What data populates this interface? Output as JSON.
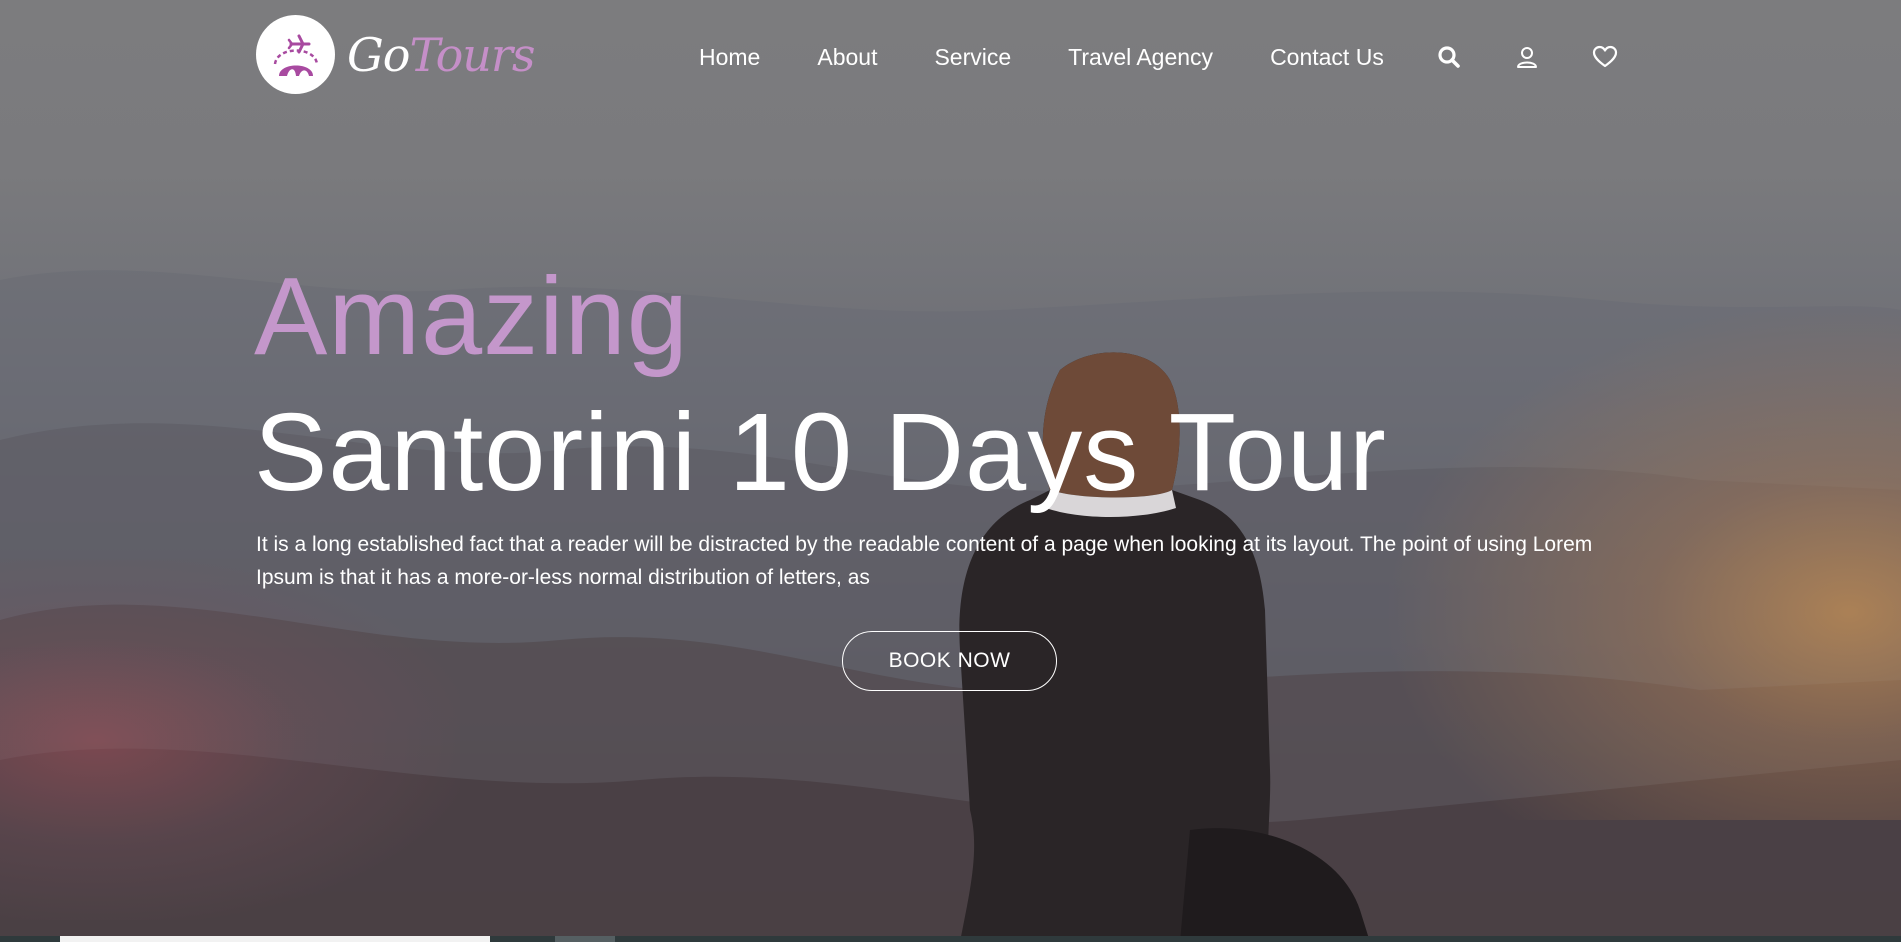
{
  "brand": {
    "name_part1": "Go",
    "name_part2": "Tours",
    "accent": "#c58fc8"
  },
  "nav": {
    "items": [
      {
        "label": "Home"
      },
      {
        "label": "About"
      },
      {
        "label": "Service"
      },
      {
        "label": "Travel Agency"
      },
      {
        "label": "Contact Us"
      }
    ],
    "icons": [
      "search-icon",
      "user-icon",
      "heart-icon"
    ]
  },
  "hero": {
    "kicker": "Amazing",
    "title": "Santorini 10 Days Tour",
    "description": "It is a long established fact that a reader will be distracted by the readable content of a page when looking at its layout. The point of using Lorem Ipsum is that it has a more-or-less normal distribution of letters, as",
    "cta_label": "BOOK NOW",
    "kicker_color": "#c497cb"
  }
}
